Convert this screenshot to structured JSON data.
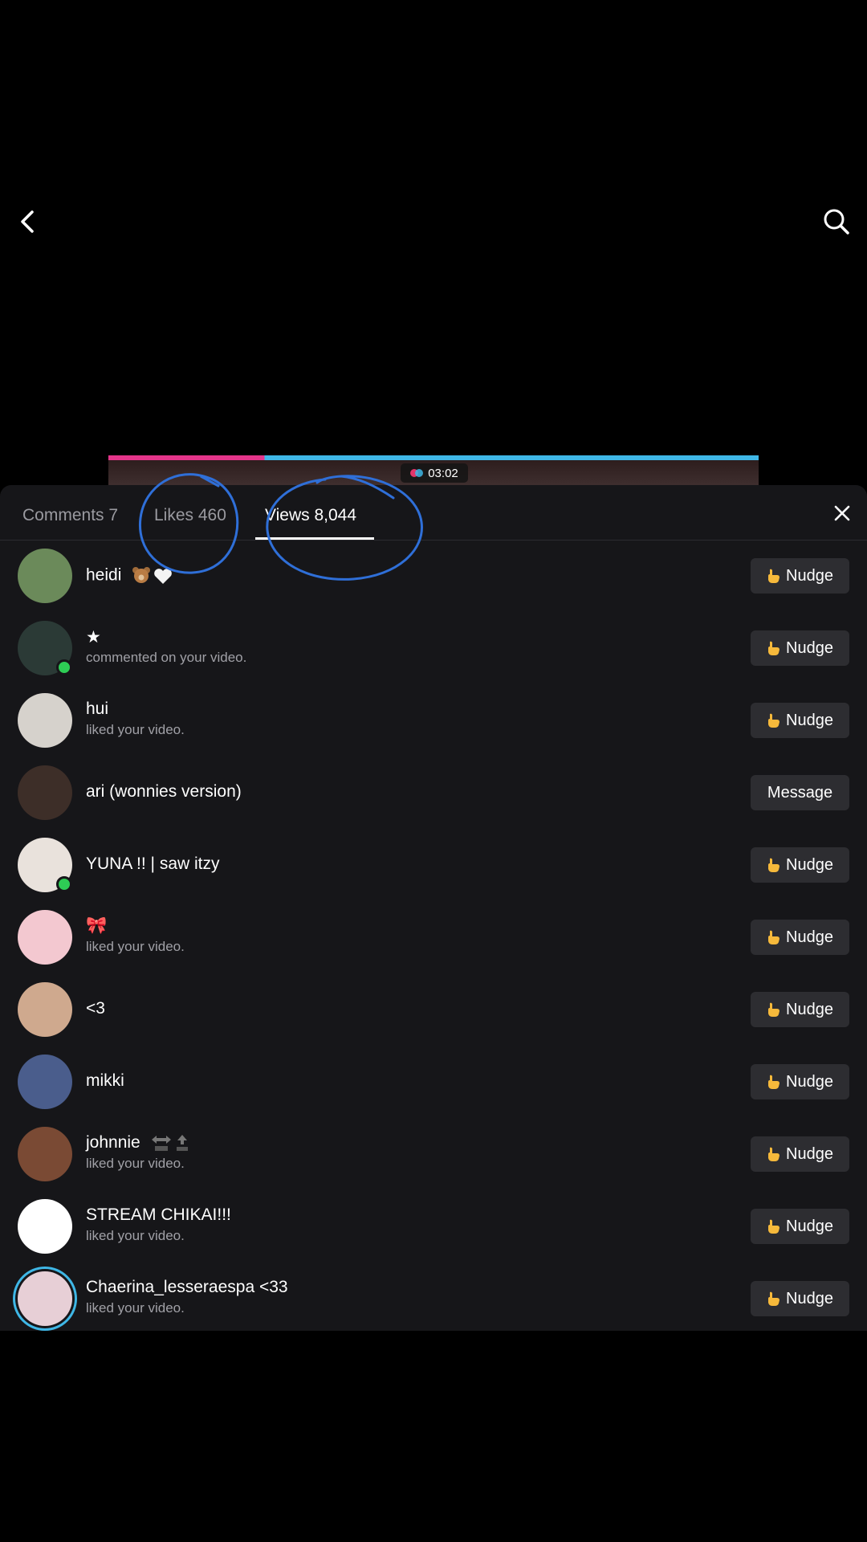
{
  "video": {
    "timer": "03:02"
  },
  "tabs": [
    {
      "label": "Comments 7",
      "active": false
    },
    {
      "label": "Likes 460",
      "active": false
    },
    {
      "label": "Views 8,044",
      "active": true
    }
  ],
  "rows": [
    {
      "name": "heidi",
      "sub": "",
      "button": "Nudge",
      "avatar_color": "#6b8a5a",
      "online": false,
      "emoji": "bear-heart"
    },
    {
      "name": "★",
      "sub": "commented on your video.",
      "button": "Nudge",
      "avatar_color": "#2b3a36",
      "online": true
    },
    {
      "name": "hui",
      "sub": "liked your video.",
      "button": "Nudge",
      "avatar_color": "#d6d2cc",
      "online": false
    },
    {
      "name": "ari (wonnies version)",
      "sub": "",
      "button": "Message",
      "avatar_color": "#3d2e28",
      "online": false
    },
    {
      "name": "YUNA !! | saw itzy",
      "sub": "",
      "button": "Nudge",
      "avatar_color": "#e9e2dc",
      "online": true
    },
    {
      "name": "🎀",
      "sub": "liked your video.",
      "button": "Nudge",
      "avatar_color": "#f3c8d0",
      "online": false
    },
    {
      "name": "<3",
      "sub": "",
      "button": "Nudge",
      "avatar_color": "#cfa98e",
      "online": false
    },
    {
      "name": "mikki",
      "sub": "",
      "button": "Nudge",
      "avatar_color": "#4a5d8c",
      "online": false
    },
    {
      "name": "johnnie",
      "sub": "liked your video.",
      "button": "Nudge",
      "avatar_color": "#7a4a34",
      "online": false
    },
    {
      "name": "STREAM CHIKAI!!!",
      "sub": "liked your video.",
      "button": "Nudge",
      "avatar_color": "#ffffff",
      "online": false
    },
    {
      "name": "Chaerina_lesseraespa <33",
      "sub": "liked your video.",
      "button": "Nudge",
      "avatar_color": "#e7cfd6",
      "online": false,
      "ring": true
    }
  ],
  "icons": {
    "back": "chevron-left-icon",
    "search": "search-icon",
    "close": "close-icon",
    "nudge": "pointing-hand-icon"
  },
  "colors": {
    "annotation": "#2f6fd8",
    "online": "#2ecc55"
  }
}
